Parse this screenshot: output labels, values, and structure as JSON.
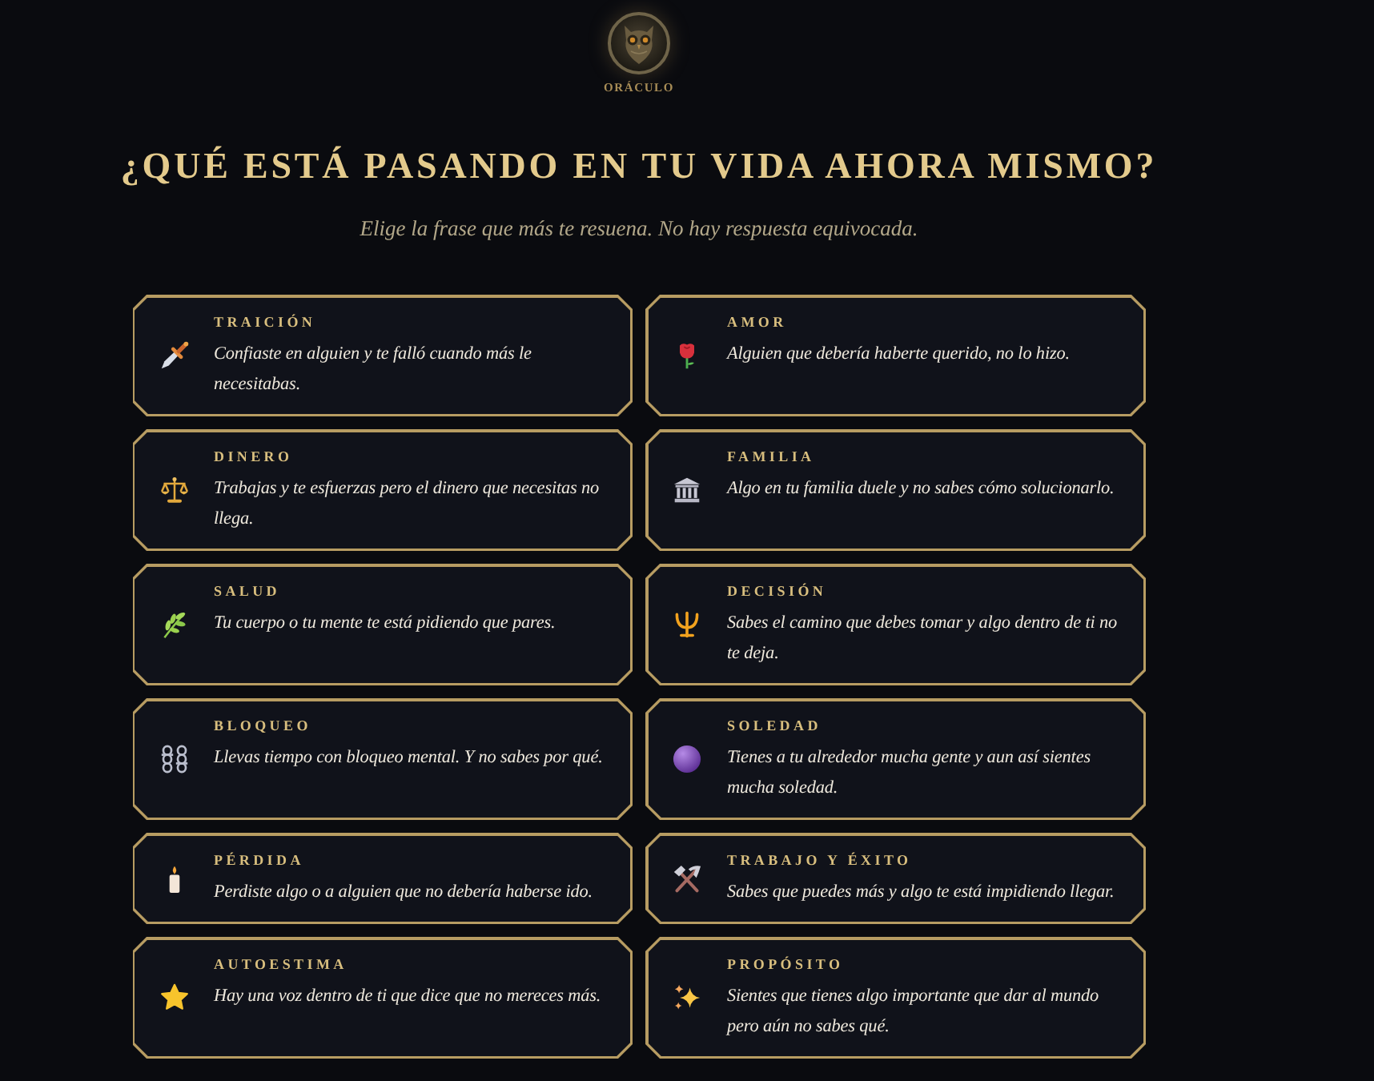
{
  "logo": {
    "name": "ORÁCULO"
  },
  "heading": "¿QUÉ ESTÁ PASANDO EN TU VIDA AHORA MISMO?",
  "subtitle": "Elige la frase que más te resuena. No hay respuesta equivocada.",
  "options": [
    {
      "title": "TRAICIÓN",
      "text": "Confiaste en alguien y te falló cuando más le necesitabas."
    },
    {
      "title": "AMOR",
      "text": "Alguien que debería haberte querido, no lo hizo."
    },
    {
      "title": "DINERO",
      "text": "Trabajas y te esfuerzas pero el dinero que necesitas no llega."
    },
    {
      "title": "FAMILIA",
      "text": "Algo en tu familia duele y no sabes cómo solucionarlo."
    },
    {
      "title": "SALUD",
      "text": "Tu cuerpo o tu mente te está pidiendo que pares."
    },
    {
      "title": "DECISIÓN",
      "text": "Sabes el camino que debes tomar y algo dentro de ti no te deja."
    },
    {
      "title": "BLOQUEO",
      "text": "Llevas tiempo con bloqueo mental. Y no sabes por qué."
    },
    {
      "title": "SOLEDAD",
      "text": "Tienes a tu alrededor mucha gente y aun así sientes mucha soledad."
    },
    {
      "title": "PÉRDIDA",
      "text": "Perdiste algo o a alguien que no debería haberse ido."
    },
    {
      "title": "TRABAJO Y ÉXITO",
      "text": "Sabes que puedes más y algo te está impidiendo llegar."
    },
    {
      "title": "AUTOESTIMA",
      "text": "Hay una voz dentro de ti que dice que no mereces más."
    },
    {
      "title": "PROPÓSITO",
      "text": "Sientes que tienes algo importante que dar al mundo pero aún no sabes qué."
    }
  ]
}
